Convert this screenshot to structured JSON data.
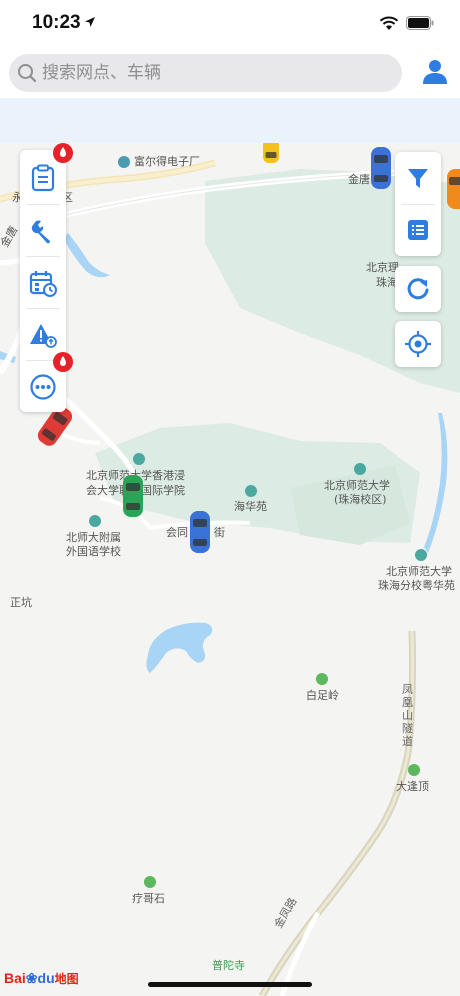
{
  "status_bar": {
    "time": "10:23"
  },
  "search": {
    "placeholder": "搜索网点、车辆"
  },
  "map": {
    "pois": {
      "fuerde": "富尔得电子厂",
      "jintang_top": "金唐",
      "bit_line1": "北京理",
      "bit_line2": "珠海",
      "bnu_hk_line1": "北京师范大学香港浸",
      "bnu_hk_line2": "会大学联合国际学院",
      "haihua": "海华苑",
      "bnu_zh_line1": "北京师范大学",
      "bnu_zh_line2": "(珠海校区)",
      "bnu_affil_line1": "北师大附属",
      "bnu_affil_line2": "外国语学校",
      "huitong": "会同",
      "huitong_suffix": "街",
      "bnu_school_line1": "北京师范大学",
      "bnu_school_line2": "珠海分校粤华苑",
      "zhengkeng": "正坑",
      "baizuling": "白足岭",
      "fenghuangshan": "凤凰山隧道",
      "dazhuding": "大逢顶",
      "jiagesh": "疗哥石",
      "jinfeng_road": "金凤路",
      "putuosi": "普陀寺",
      "yong_partial": "永",
      "qu_partial": "区",
      "jintang_left": "金唐"
    }
  },
  "baidu_logo": {
    "text1": "Bai",
    "text2": "du",
    "text_cn": "地图"
  },
  "colors": {
    "accent": "#2f7de1",
    "badge_red": "#e5212a",
    "green_area": "#dcebe3",
    "water": "#a8d4f5",
    "car_yellow": "#f2c21a",
    "car_blue": "#3a73d8",
    "car_red": "#de3a36",
    "car_green": "#2aa558",
    "car_orange": "#f08a1c"
  },
  "icons": {
    "left_toolbar": [
      "clipboard-icon",
      "wrench-icon",
      "calendar-clock-icon",
      "warning-icon",
      "more-icon"
    ],
    "right": [
      "filter-icon",
      "list-icon",
      "refresh-icon",
      "locate-icon"
    ]
  }
}
